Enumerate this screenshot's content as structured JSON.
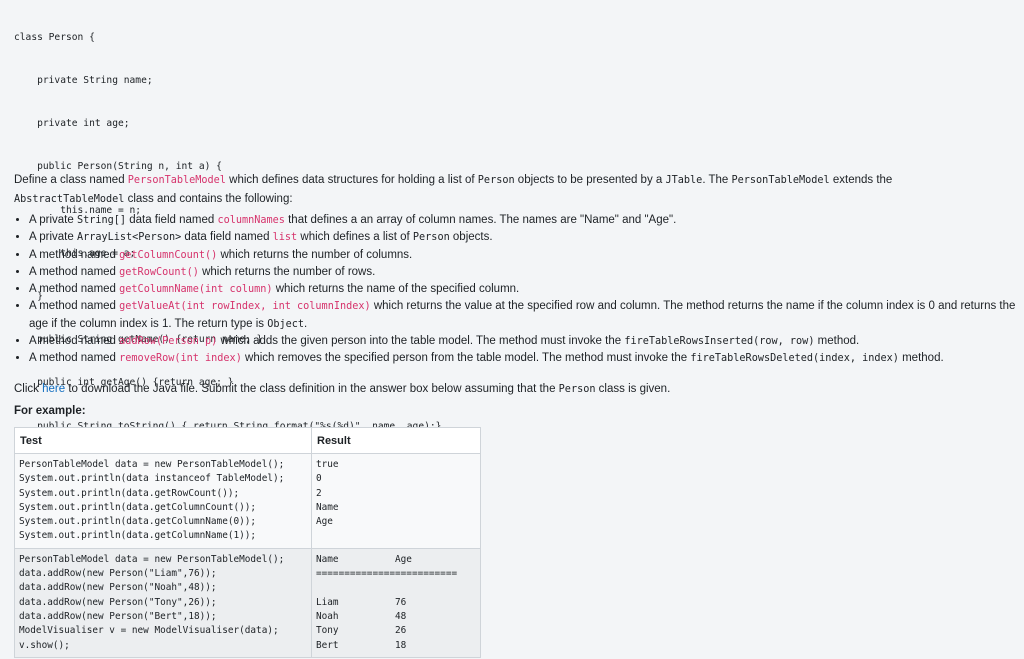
{
  "code_lines": [
    "class Person {",
    "    private String name;",
    "    private int age;",
    "    public Person(String n, int a) {",
    "        this.name = n;",
    "        this.age = a;",
    "    }",
    "    public String getName() {return name; }",
    "    public int getAge() {return age; }",
    "    public String toString() { return String.format(\"%s(%d)\", name, age);}",
    "}"
  ],
  "intro": {
    "t1": "Define a class named ",
    "classname": "PersonTableModel",
    "t2": " which defines data structures for holding a list of ",
    "person": "Person",
    "t3": " objects to be presented by a ",
    "jtable": "JTable",
    "t4": ". The ",
    "classname2": "PersonTableModel",
    "t5": " extends the",
    "abstract": "AbstractTableModel",
    "t6": " class and contains the following:"
  },
  "bullets": {
    "b1": {
      "a": "A private ",
      "code": "String[]",
      "b": " data field named ",
      "pink": "columnNames",
      "c": " that defines a an array of column names. The names are \"Name\" and \"Age\"."
    },
    "b2": {
      "a": "A private ",
      "code": "ArrayList<Person>",
      "b": " data field named ",
      "pink": "list",
      "c": " which defines a list of ",
      "code2": "Person",
      "d": " objects."
    },
    "b3": {
      "a": "A method named ",
      "pink": "getColumnCount()",
      "b": " which returns the number of columns."
    },
    "b4": {
      "a": "A method named ",
      "pink": "getRowCount()",
      "b": " which returns the number of rows."
    },
    "b5": {
      "a": "A method named ",
      "pink": "getColumnName(int column)",
      "b": " which returns the name of the specified column."
    },
    "b6": {
      "a": "A method named ",
      "pink": "getValueAt(int rowIndex, int columnIndex)",
      "b": " which returns the value at the specified row and column. The method returns the name if the column index is 0 and returns the age if the column index is 1. The return type is ",
      "code": "Object",
      "c": "."
    },
    "b7": {
      "a": "A method named ",
      "pink": "addRow(Person p)",
      "b": " which adds the given person into the table model. The method must invoke the ",
      "code": "fireTableRowsInserted(row, row)",
      "c": " method."
    },
    "b8": {
      "a": "A method named ",
      "pink": "removeRow(int index)",
      "b": " which removes the specified person from the table model. The method must invoke the ",
      "code": "fireTableRowsDeleted(index, index)",
      "c": " method."
    }
  },
  "download": {
    "a": "Click ",
    "link": "here",
    "b": " to download the Java file. Submit the class definition in the answer box below assuming that the ",
    "code": "Person",
    "c": " class is given."
  },
  "for_example": "For example:",
  "table": {
    "headers": [
      "Test",
      "Result"
    ],
    "rows": [
      {
        "test": [
          "PersonTableModel data = new PersonTableModel();",
          "System.out.println(data instanceof TableModel);",
          "System.out.println(data.getRowCount());",
          "System.out.println(data.getColumnCount());",
          "System.out.println(data.getColumnName(0));",
          "System.out.println(data.getColumnName(1));"
        ],
        "result": [
          "true",
          "0",
          "2",
          "Name",
          "Age"
        ]
      },
      {
        "test": [
          "PersonTableModel data = new PersonTableModel();",
          "data.addRow(new Person(\"Liam\",76));",
          "data.addRow(new Person(\"Noah\",48));",
          "data.addRow(new Person(\"Tony\",26));",
          "data.addRow(new Person(\"Bert\",18));",
          "ModelVisualiser v = new ModelVisualiser(data);",
          "v.show();"
        ],
        "result": [
          "Name          Age",
          "=========================",
          "",
          "Liam          76",
          "Noah          48",
          "Tony          26",
          "Bert          18"
        ]
      }
    ]
  }
}
